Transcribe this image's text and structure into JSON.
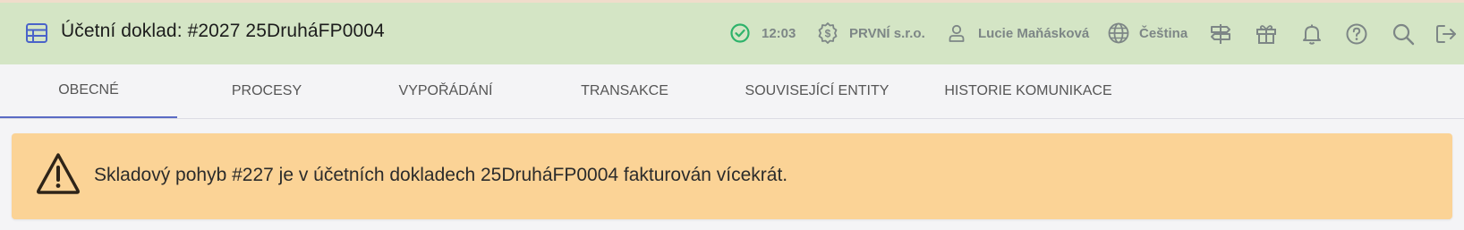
{
  "header": {
    "title": "Účetní doklad: #2027 25DruháFP0004",
    "status_time": "12:03",
    "company": "PRVNÍ s.r.o.",
    "user": "Lucie Maňásková",
    "language": "Čeština",
    "icons": [
      "table-icon",
      "check-circle-icon",
      "money-cog-icon",
      "user-icon",
      "globe-icon",
      "signpost-icon",
      "gift-icon",
      "bell-icon",
      "help-circle-icon",
      "search-icon",
      "logout-icon"
    ],
    "colors": {
      "background": "#d4e5c5",
      "status_ok": "#2fb36b",
      "accent": "#5a6bc4"
    }
  },
  "tabs": [
    {
      "label": "OBECNÉ",
      "active": true
    },
    {
      "label": "PROCESY",
      "active": false
    },
    {
      "label": "VYPOŘÁDÁNÍ",
      "active": false
    },
    {
      "label": "TRANSAKCE",
      "active": false
    },
    {
      "label": "SOUVISEJÍCÍ ENTITY",
      "active": false
    },
    {
      "label": "HISTORIE KOMUNIKACE",
      "active": false
    }
  ],
  "alert": {
    "icon": "warning-triangle-icon",
    "message": "Skladový pohyb #227 je v účetních dokladech 25DruháFP0004 fakturován vícekrát.",
    "color": "#fbd396"
  }
}
